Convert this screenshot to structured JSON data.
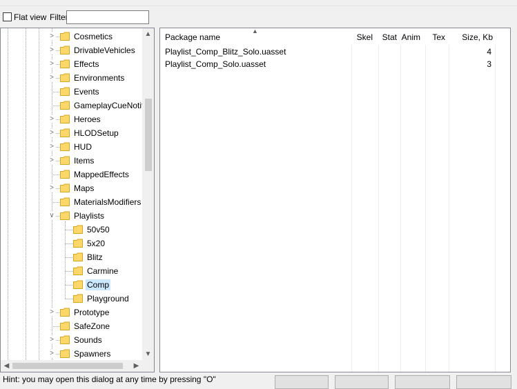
{
  "toolbar": {
    "flat_view_label": "Flat view",
    "filter_label": "Filter:",
    "filter_value": ""
  },
  "tree": {
    "items": [
      {
        "label": "Cosmetics",
        "level": 1,
        "expander": "collapsed",
        "selected": false
      },
      {
        "label": "DrivableVehicles",
        "level": 1,
        "expander": "collapsed",
        "selected": false
      },
      {
        "label": "Effects",
        "level": 1,
        "expander": "collapsed",
        "selected": false
      },
      {
        "label": "Environments",
        "level": 1,
        "expander": "collapsed",
        "selected": false
      },
      {
        "label": "Events",
        "level": 1,
        "expander": "none",
        "selected": false
      },
      {
        "label": "GameplayCueNotifies",
        "level": 1,
        "expander": "none",
        "selected": false
      },
      {
        "label": "Heroes",
        "level": 1,
        "expander": "collapsed",
        "selected": false
      },
      {
        "label": "HLODSetup",
        "level": 1,
        "expander": "collapsed",
        "selected": false
      },
      {
        "label": "HUD",
        "level": 1,
        "expander": "collapsed",
        "selected": false
      },
      {
        "label": "Items",
        "level": 1,
        "expander": "collapsed",
        "selected": false
      },
      {
        "label": "MappedEffects",
        "level": 1,
        "expander": "none",
        "selected": false
      },
      {
        "label": "Maps",
        "level": 1,
        "expander": "collapsed",
        "selected": false
      },
      {
        "label": "MaterialsModifiers",
        "level": 1,
        "expander": "none",
        "selected": false
      },
      {
        "label": "Playlists",
        "level": 1,
        "expander": "expanded",
        "selected": false
      },
      {
        "label": "50v50",
        "level": 2,
        "expander": "none",
        "selected": false
      },
      {
        "label": "5x20",
        "level": 2,
        "expander": "none",
        "selected": false
      },
      {
        "label": "Blitz",
        "level": 2,
        "expander": "none",
        "selected": false
      },
      {
        "label": "Carmine",
        "level": 2,
        "expander": "none",
        "selected": false
      },
      {
        "label": "Comp",
        "level": 2,
        "expander": "none",
        "selected": true
      },
      {
        "label": "Playground",
        "level": 2,
        "expander": "none",
        "selected": false
      },
      {
        "label": "Prototype",
        "level": 1,
        "expander": "collapsed",
        "selected": false
      },
      {
        "label": "SafeZone",
        "level": 1,
        "expander": "none",
        "selected": false
      },
      {
        "label": "Sounds",
        "level": 1,
        "expander": "collapsed",
        "selected": false
      },
      {
        "label": "Spawners",
        "level": 1,
        "expander": "collapsed",
        "selected": false
      }
    ]
  },
  "list": {
    "columns": [
      "Package name",
      "Skel",
      "Stat",
      "Anim",
      "Tex",
      "Size, Kb"
    ],
    "sort_column": "Package name",
    "rows": [
      {
        "name": "Playlist_Comp_Blitz_Solo.uasset",
        "skel": "",
        "stat": "",
        "anim": "",
        "tex": "",
        "size": "4"
      },
      {
        "name": "Playlist_Comp_Solo.uasset",
        "skel": "",
        "stat": "",
        "anim": "",
        "tex": "",
        "size": "3"
      }
    ]
  },
  "status": {
    "hint": "Hint: you may open this dialog at any time by pressing \"O\""
  },
  "colors": {
    "selection": "#cce8ff",
    "folder": "#fcd86b",
    "border": "#828790"
  },
  "icons": {
    "folder": "folder-icon",
    "expand": "chevron-right-icon",
    "collapse": "chevron-down-icon"
  }
}
